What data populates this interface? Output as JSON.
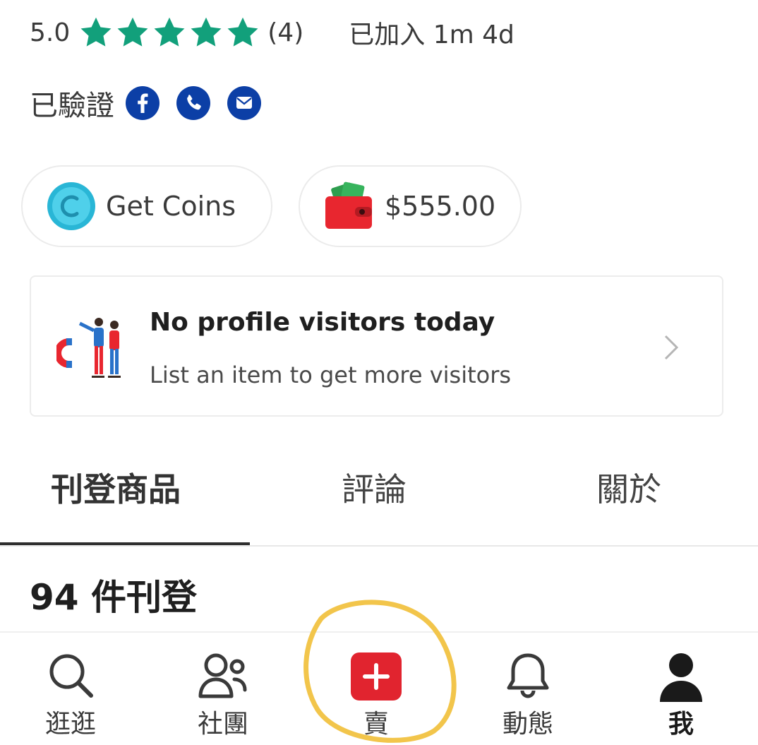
{
  "profile": {
    "rating_value": "5.0",
    "rating_stars": 5,
    "rating_count": "(4)",
    "joined": "已加入 1m 4d",
    "verified_label": "已驗證",
    "verified_icons": [
      "facebook-icon",
      "phone-icon",
      "email-icon"
    ]
  },
  "pills": {
    "coins_label": "Get Coins",
    "wallet_amount": "$555.00"
  },
  "visitors": {
    "title": "No profile visitors today",
    "subtitle": "List an item to get more visitors"
  },
  "tabs": [
    {
      "label": "刊登商品",
      "active": true
    },
    {
      "label": "評論",
      "active": false
    },
    {
      "label": "關於",
      "active": false
    }
  ],
  "listings": {
    "count_label": "94 件刊登"
  },
  "bottom_nav": [
    {
      "label": "逛逛",
      "icon": "search-icon"
    },
    {
      "label": "社團",
      "icon": "community-icon"
    },
    {
      "label": "賣",
      "icon": "plus-icon"
    },
    {
      "label": "動態",
      "icon": "bell-icon"
    },
    {
      "label": "我",
      "icon": "user-icon"
    }
  ],
  "colors": {
    "star": "#12a07b",
    "verify_badge": "#0c3fa6",
    "coin": "#29b6d6",
    "sell_button": "#e1242f",
    "wallet": "#e8262f",
    "highlight": "#f2c54b"
  }
}
